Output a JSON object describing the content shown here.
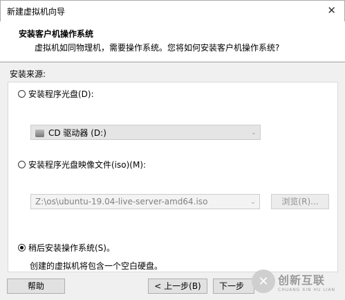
{
  "window": {
    "title": "新建虚拟机向导",
    "close_icon": "close-icon"
  },
  "header": {
    "title": "安装客户机操作系统",
    "subtitle": "虚拟机如同物理机，需要操作系统。您将如何安装客户机操作系统?"
  },
  "source": {
    "label": "安装来源:",
    "option_disc": {
      "label": "安装程序光盘(D):",
      "selected": false
    },
    "disc_select": {
      "value": "CD 驱动器 (D:)"
    },
    "option_iso": {
      "label": "安装程序光盘映像文件(iso)(M):",
      "selected": false
    },
    "iso_select": {
      "value": "Z:\\os\\ubuntu-19.04-live-server-amd64.iso"
    },
    "browse_label": "浏览(R)...",
    "option_later": {
      "label": "稍后安装操作系统(S)。",
      "selected": true
    },
    "later_desc": "创建的虚拟机将包含一个空白硬盘。"
  },
  "footer": {
    "help_label": "帮助",
    "back_label": "< 上一步(B)",
    "next_label": "下一步"
  },
  "watermark": {
    "text_cn": "创新互联",
    "text_en": "CHUANG XIN HU LIAN",
    "mark": "✕"
  }
}
